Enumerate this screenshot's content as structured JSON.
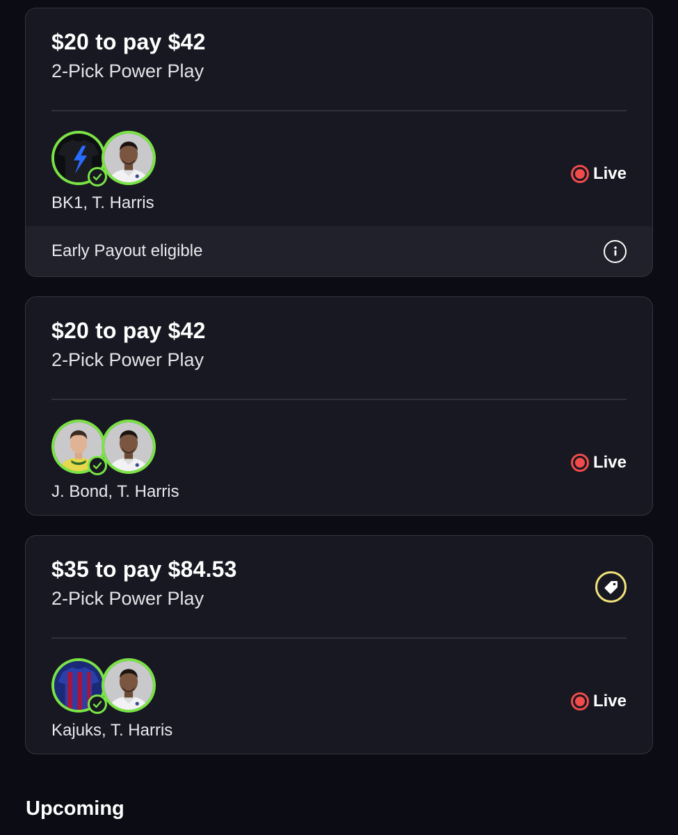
{
  "entries": [
    {
      "stake_label": "$20 to pay $42",
      "play_type": "2-Pick Power Play",
      "players": "BK1, T. Harris",
      "status": "Live",
      "early_payout": "Early Payout eligible",
      "avatar_1": "jersey-black-blue-bolt",
      "avatar_2": "player-photo-harris"
    },
    {
      "stake_label": "$20 to pay $42",
      "play_type": "2-Pick Power Play",
      "players": "J. Bond, T. Harris",
      "status": "Live",
      "avatar_1": "player-photo-bond",
      "avatar_2": "player-photo-harris"
    },
    {
      "stake_label": "$35 to pay $84.53",
      "play_type": "2-Pick Power Play",
      "players": "Kajuks, T. Harris",
      "status": "Live",
      "badge_icon": "tag-icon",
      "avatar_1": "jersey-blue-red-stripes",
      "avatar_2": "player-photo-harris"
    }
  ],
  "upcoming_title": "Upcoming",
  "colors": {
    "background": "#0b0c14",
    "card": "#171821",
    "accent_green": "#7be346",
    "live_red": "#f24b4b",
    "promo_yellow": "#f1e27a"
  }
}
